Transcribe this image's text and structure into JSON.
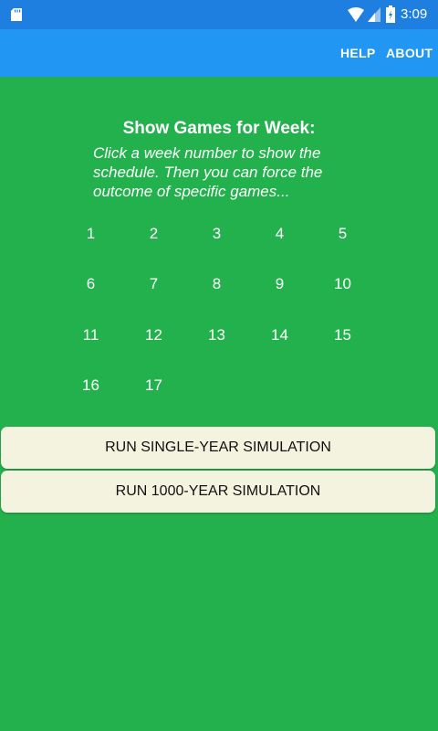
{
  "status_bar": {
    "time": "3:09",
    "icons": [
      "sd-card-icon",
      "wifi-icon",
      "signal-icon",
      "battery-charging-icon"
    ]
  },
  "app_bar": {
    "actions": [
      {
        "label": "HELP"
      },
      {
        "label": "ABOUT"
      }
    ]
  },
  "main": {
    "heading": "Show Games for Week:",
    "instructions": "Click a week number to show the schedule. Then you can force the outcome of specific games...",
    "weeks": [
      "1",
      "2",
      "3",
      "4",
      "5",
      "6",
      "7",
      "8",
      "9",
      "10",
      "11",
      "12",
      "13",
      "14",
      "15",
      "16",
      "17"
    ]
  },
  "buttons": {
    "single_year": "RUN SINGLE-YEAR SIMULATION",
    "thousand_year": "RUN 1000-YEAR SIMULATION"
  },
  "colors": {
    "status_bar": "#1e7fe0",
    "app_bar": "#2196f3",
    "background": "#22b14c",
    "button": "#f3f3df"
  }
}
